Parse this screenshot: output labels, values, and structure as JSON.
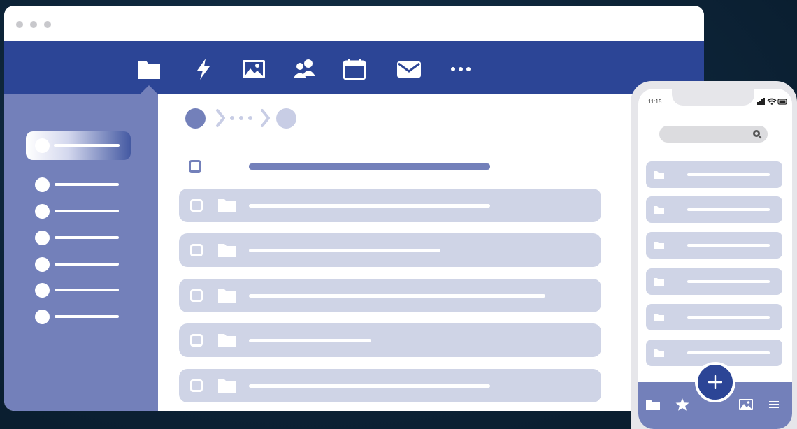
{
  "desktop": {
    "nav_icons": [
      "folder-icon",
      "lightning-icon",
      "image-icon",
      "contacts-icon",
      "calendar-icon",
      "mail-icon",
      "more-icon"
    ],
    "active_nav": "folder-icon",
    "sidebar_items": 7,
    "active_sidebar_item": 1,
    "breadcrumb": [
      "root",
      "...",
      "current"
    ],
    "file_rows": 5
  },
  "phone": {
    "status_time": "11:15",
    "status_icons": [
      "signal-icon",
      "wifi-icon",
      "battery-icon"
    ],
    "search_icon": "search-icon",
    "list_rows": 6,
    "tab_icons": [
      "folder-icon",
      "star-icon",
      "image-icon",
      "menu-icon"
    ],
    "fab_icon": "plus-icon"
  },
  "colors": {
    "primary": "#2c4596",
    "sidebar": "#7380ba",
    "row": "#cfd4e6",
    "background": "#0d2438",
    "breadcrumb_current": "#c8cde5"
  }
}
